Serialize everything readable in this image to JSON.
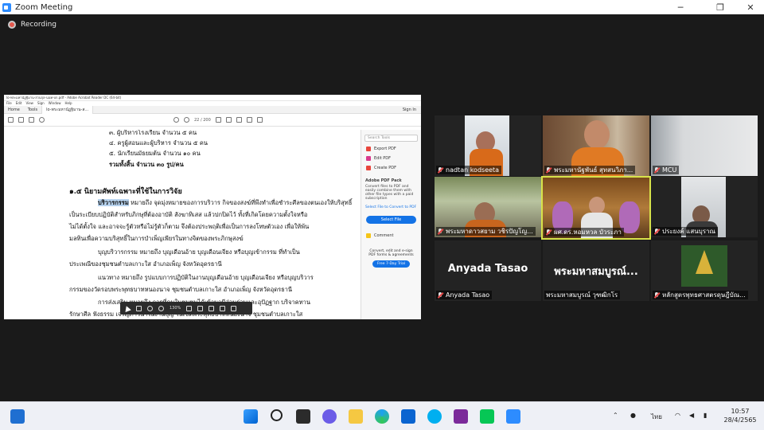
{
  "window": {
    "title": "Zoom Meeting",
    "minimize": "─",
    "maximize": "❐",
    "close": "✕"
  },
  "recording": {
    "label": "Recording"
  },
  "share": {
    "acrobat": {
      "title_bar": "lo-พระมหานัฏฐิมาน-สวนกุล-นนท-บก.pdf - Adobe Acrobat Reader DC (64-bit)",
      "menu": [
        "File",
        "Edit",
        "View",
        "Sign",
        "Window",
        "Help"
      ],
      "tabs": [
        "Home",
        "Tools",
        "lo-พระมหานัฏฐิมาน-ส..."
      ],
      "sign_in": "Sign In",
      "page_indicator": "22 / 200",
      "zoom_level": "130%",
      "side_panel": {
        "search": "Search Tools",
        "tools": [
          {
            "label": "Export PDF",
            "color": "#e8453c"
          },
          {
            "label": "Edit PDF",
            "color": "#e8453c"
          },
          {
            "label": "Create PDF",
            "color": "#e8453c"
          }
        ],
        "pack_title": "Adobe PDF Pack",
        "pack_text": "Convert files to PDF and easily combine them with other file types with a paid subscription",
        "convert_link": "Select File to Convert to PDF",
        "select_button": "Select File",
        "comment": "Comment",
        "footer": "Convert, edit and e-sign PDF forms & agreements",
        "trial_button": "Free 7-Day Trial"
      }
    },
    "doc_lines": [
      {
        "text": "๓. ผู้บริหารโรงเรียน                    จำนวน ๕ คน",
        "bold": false
      },
      {
        "text": "๔. ครูผู้สอนและผู้บริหาร                  จำนวน ๕ คน",
        "bold": false
      },
      {
        "text": "๕. นักเรียนมัธยมต้น                      จำนวน ๑๐ คน",
        "bold": false
      },
      {
        "text": "รวมทั้งสิ้น                                   จำนวน ๓๐ รูป/คน",
        "bold": true
      },
      {
        "text": "๑.๕ นิยามศัพท์เฉพาะที่ใช้ในการวิจัย",
        "bold": true
      },
      {
        "text": "บริวารกรรม หมายถึง จุดมุ่งหมายของการบริวาร กิจของสงฆ์ที่พึงทำเพื่อชำระศีลของตนเองให้บริสุทธิ์",
        "bold": false
      },
      {
        "text": "เป็นระเบียบปฏิบัติสำหรับภิกษุที่ต้องอาบัติ สังฆาทิเสส แล้วปกปิดไว้ ทั้งที่เกิดโดยความตั้งใจหรือ",
        "bold": false
      },
      {
        "text": "ไม่ได้ตั้งใจ และอาจจะรู้ตัวหรือไม่รู้ตัวก็ตาม จึงต้องประพฤติเพื่อเป็นการลงโทษตัวเอง เพื่อให้พ้น",
        "bold": false
      },
      {
        "text": "มลทินเพื่อความบริสุทธิ์ในการบำเพ็ญเพียรในทางจิตของพระภิกษุสงฆ์",
        "bold": false
      },
      {
        "text": "บุญบริวารกรรม หมายถึง บุญเดือนอ้าย บุญเดือนเจียง หรือบุญเข้ากรรม ที่ทำเป็น",
        "bold": false
      },
      {
        "text": "ประเพณีของชุมชนตำบลเกาะใส อำเภอเพ็ญ จังหวัดอุดรธานี",
        "bold": false
      },
      {
        "text": "แนวทาง หมายถึง รูปแบบการปฏิบัติในงานบุญเดือนอ้าย บุญเดือนเจียง หรือบุญบริวาร",
        "bold": false
      },
      {
        "text": "กรรมของวัดรอบพระพุทธบาทหนองนาจ ชุมชนตำบลเกาะใส อำเภอเพ็ญ จังหวัดอุดรธานี",
        "bold": false
      },
      {
        "text": "การส่งเสริม หมายถึง การที่คนในชุมชนได้เข้ามามีส่วนร่วมและอุปัฏฐาก บริจาคทาน",
        "bold": false
      },
      {
        "text": "รักษาศีล ฟังธรรม เจริญภาวนาในงานบุญ ในเขตพระพุทธบาทหนองนาจ ชุมชนตำบลเกาะใส",
        "bold": false
      }
    ]
  },
  "participants": [
    {
      "name": "nadtan kodseeta",
      "big": ""
    },
    {
      "name": "พระมหานัฐพันธ์ สุทสนวิภา...",
      "big": ""
    },
    {
      "name": "MCU",
      "big": ""
    },
    {
      "name": "พระมหาดาวสยาม วชิรปัญโญ...",
      "big": ""
    },
    {
      "name": "ผศ.ดร.หอมหวล บัวระภา",
      "big": ""
    },
    {
      "name": "ประยงค์ แสนบุราณ",
      "big": ""
    },
    {
      "name": "Anyada Tasao",
      "big": "Anyada Tasao"
    },
    {
      "name": "พระมหาสมบูรณ์ วุฑฒิกโร",
      "big": "พระมหาสมบูรณ์..."
    },
    {
      "name": "หลักสูตรพุทธศาสตรดุษฎีบัณ...",
      "big": ""
    }
  ],
  "taskbar": {
    "language": "ไทย",
    "time": "10:57",
    "date": "28/4/2565",
    "colors": {
      "accent": "#2d8cff",
      "bg": "#1a1a1a",
      "active_border": "#d8e34a"
    }
  }
}
